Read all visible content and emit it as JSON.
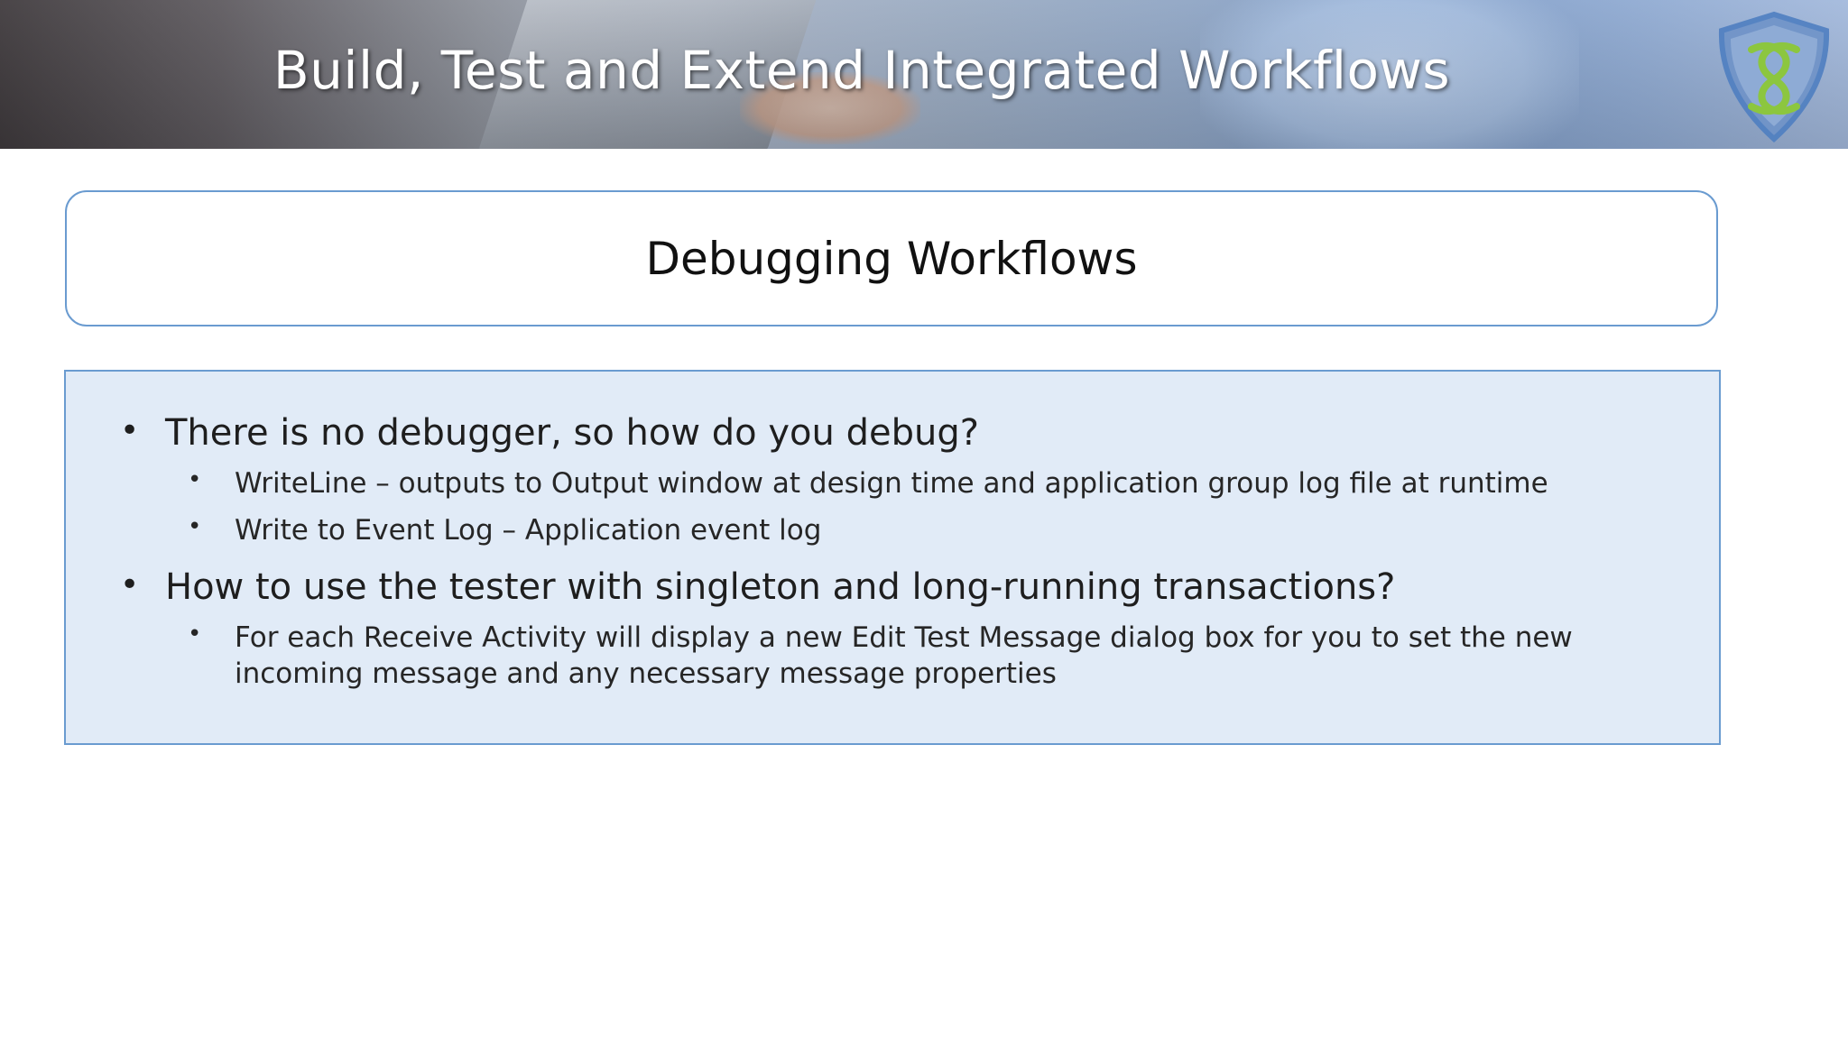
{
  "header": {
    "title": "Build, Test and Extend Integrated Workflows"
  },
  "colors": {
    "accent_border": "#6a9bd0",
    "content_background": "#e1ebf7",
    "logo_shield": "#4f7fc1",
    "logo_knot": "#8cc63f"
  },
  "section": {
    "title": "Debugging Workflows"
  },
  "bullets": [
    {
      "text": "There is no debugger, so how do you debug?",
      "sub": [
        "WriteLine – outputs to Output window at design time and application group log file at runtime",
        "Write to Event Log – Application event log"
      ]
    },
    {
      "text": "How to use the tester with singleton and long-running transactions?",
      "sub": [
        "For each Receive Activity will display a new Edit Test Message dialog box for you to set the new incoming message and any necessary message properties"
      ]
    }
  ],
  "bullet_symbol": "•"
}
